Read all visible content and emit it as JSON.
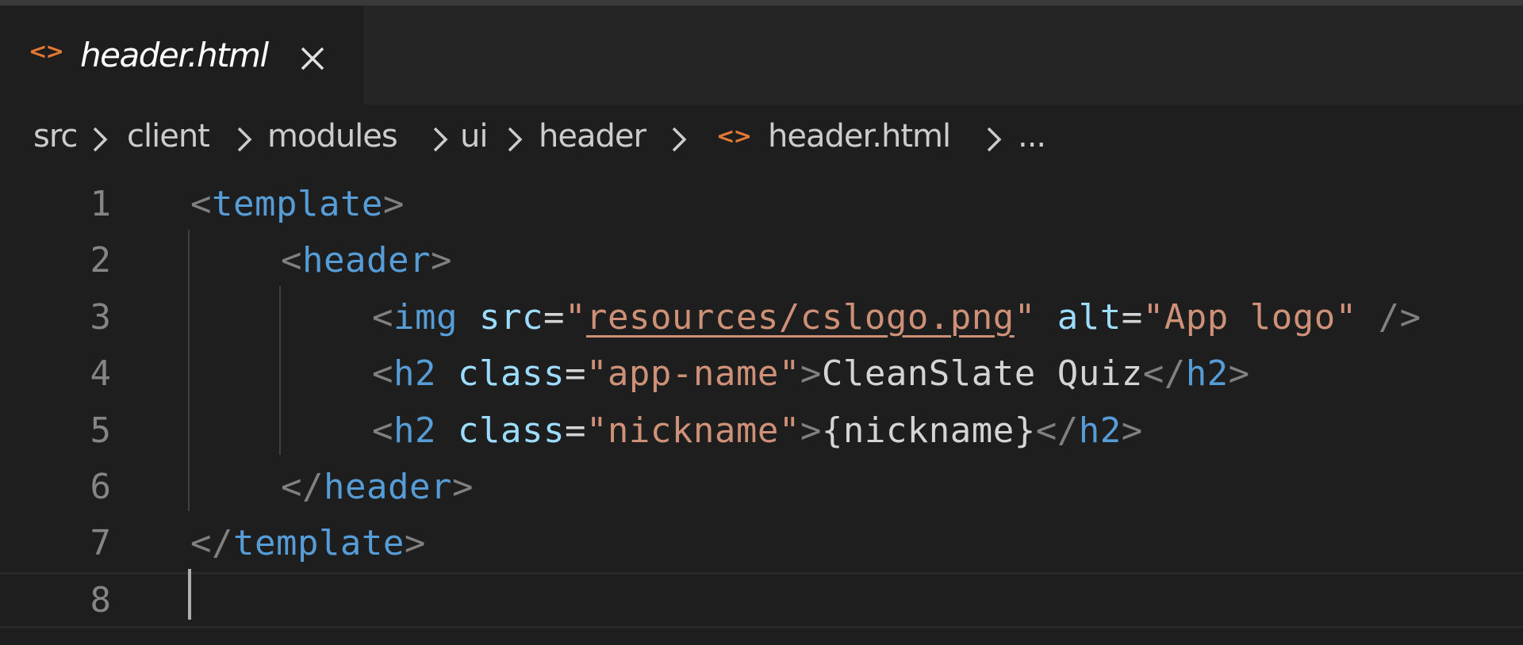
{
  "tab": {
    "icon": "html-file-icon",
    "label": "header.html",
    "close_glyph": "close-icon"
  },
  "breadcrumb": {
    "items": [
      "src",
      "client",
      "modules",
      "ui",
      "header",
      "header.html",
      "..."
    ],
    "separator": "chevron-right-icon",
    "file_icon": "html-file-icon"
  },
  "editor": {
    "language": "html",
    "current_line": 8,
    "lines": [
      {
        "number": "1",
        "tokens": [
          [
            "punct",
            "<"
          ],
          [
            "tag",
            "template"
          ],
          [
            "punct",
            ">"
          ]
        ]
      },
      {
        "number": "2",
        "tokens": [
          [
            "punct",
            "<"
          ],
          [
            "tag",
            "header"
          ],
          [
            "punct",
            ">"
          ]
        ]
      },
      {
        "number": "3",
        "tokens": [
          [
            "punct",
            "<"
          ],
          [
            "tag",
            "img"
          ],
          [
            "text",
            " "
          ],
          [
            "attr",
            "src"
          ],
          [
            "eq",
            "="
          ],
          [
            "str",
            "\""
          ],
          [
            "link",
            "resources/cslogo.png"
          ],
          [
            "str",
            "\""
          ],
          [
            "text",
            " "
          ],
          [
            "attr",
            "alt"
          ],
          [
            "eq",
            "="
          ],
          [
            "str",
            "\"App logo\""
          ],
          [
            "text",
            " "
          ],
          [
            "punct",
            "/>"
          ]
        ]
      },
      {
        "number": "4",
        "tokens": [
          [
            "punct",
            "<"
          ],
          [
            "tag",
            "h2"
          ],
          [
            "text",
            " "
          ],
          [
            "attr",
            "class"
          ],
          [
            "eq",
            "="
          ],
          [
            "str",
            "\"app-name\""
          ],
          [
            "punct",
            ">"
          ],
          [
            "text",
            "CleanSlate Quiz"
          ],
          [
            "punct",
            "</"
          ],
          [
            "tag",
            "h2"
          ],
          [
            "punct",
            ">"
          ]
        ]
      },
      {
        "number": "5",
        "tokens": [
          [
            "punct",
            "<"
          ],
          [
            "tag",
            "h2"
          ],
          [
            "text",
            " "
          ],
          [
            "attr",
            "class"
          ],
          [
            "eq",
            "="
          ],
          [
            "str",
            "\"nickname\""
          ],
          [
            "punct",
            ">"
          ],
          [
            "text",
            "{nickname}"
          ],
          [
            "punct",
            "</"
          ],
          [
            "tag",
            "h2"
          ],
          [
            "punct",
            ">"
          ]
        ]
      },
      {
        "number": "6",
        "tokens": [
          [
            "punct",
            "</"
          ],
          [
            "tag",
            "header"
          ],
          [
            "punct",
            ">"
          ]
        ]
      },
      {
        "number": "7",
        "tokens": [
          [
            "punct",
            "</"
          ],
          [
            "tag",
            "template"
          ],
          [
            "punct",
            ">"
          ]
        ]
      },
      {
        "number": "8",
        "tokens": []
      }
    ]
  },
  "colors": {
    "background": "#1e1e1e",
    "tag": "#569cd6",
    "attribute": "#9cdcfe",
    "string": "#ce9178",
    "punctuation": "#808080",
    "text": "#d4d4d4",
    "html_icon": "#e37933"
  }
}
